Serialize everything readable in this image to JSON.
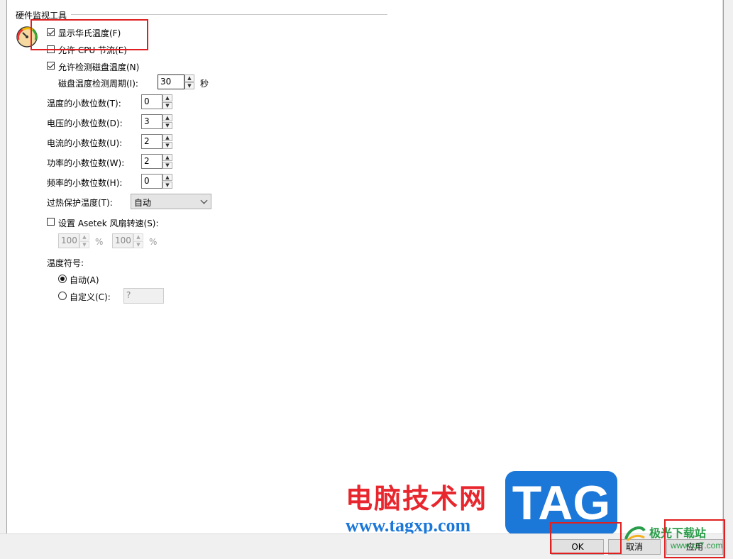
{
  "group": {
    "title": "硬件监视工具"
  },
  "options": {
    "show_fahrenheit": {
      "label": "显示华氏温度(F)",
      "checked": true
    },
    "allow_cpu_throttle": {
      "label": "允许 CPU 节流(E)",
      "checked": false
    },
    "allow_disk_temp": {
      "label": "允许检测磁盘温度(N)",
      "checked": true
    },
    "disk_period": {
      "label": "磁盘温度检测周期(I):",
      "value": "30",
      "unit": "秒"
    }
  },
  "decimals": [
    {
      "label": "温度的小数位数(T):",
      "value": "0"
    },
    {
      "label": "电压的小数位数(D):",
      "value": "3"
    },
    {
      "label": "电流的小数位数(U):",
      "value": "2"
    },
    {
      "label": "功率的小数位数(W):",
      "value": "2"
    },
    {
      "label": "频率的小数位数(H):",
      "value": "0"
    }
  ],
  "overheat": {
    "label": "过热保护温度(T):",
    "selected": "自动"
  },
  "asetek": {
    "label": "设置 Asetek 风扇转速(S):",
    "checked": false,
    "value1": "100",
    "unit1": "%",
    "value2": "100",
    "unit2": "%"
  },
  "temp_symbol": {
    "label": "温度符号:",
    "auto": {
      "label": "自动(A)",
      "selected": true
    },
    "custom": {
      "label": "自定义(C):",
      "selected": false,
      "value": "?"
    }
  },
  "buttons": {
    "ok": "OK",
    "cancel": "取消",
    "apply": "应用"
  },
  "watermark": {
    "site_name": "电脑技术网",
    "site_url": "www.tagxp.com",
    "logo": "TAG",
    "corner_brand": "极光下载站",
    "corner_url": "www.xz7.com"
  },
  "colors": {
    "highlight": "#e02020",
    "tag_blue": "#1b77d8",
    "watermark_red": "#e8262d"
  }
}
